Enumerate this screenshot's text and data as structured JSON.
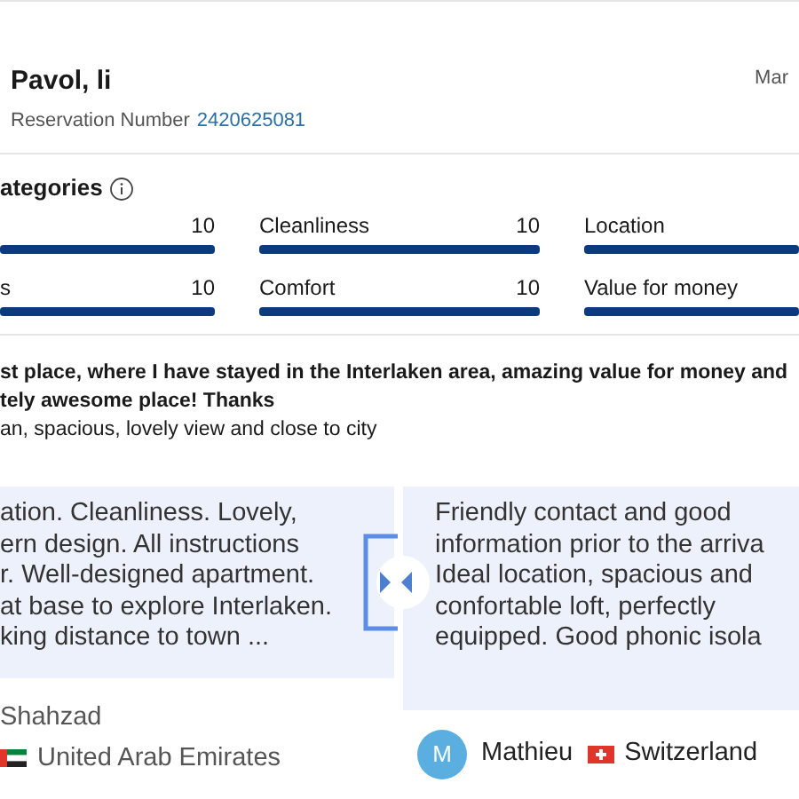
{
  "guest": {
    "name": "Pavol, li",
    "reservation_label": "Reservation Number",
    "reservation_number": "2420625081",
    "date": "Mar"
  },
  "categories": {
    "title": "ategories",
    "items": [
      {
        "score": "10",
        "level": 1
      },
      {
        "label": "Cleanliness",
        "score": "10",
        "level": 1
      },
      {
        "label": "Location",
        "level": 1
      },
      {
        "label": "s",
        "score": "10",
        "level": 1
      },
      {
        "label": "Comfort",
        "score": "10",
        "level": 1
      },
      {
        "label": "Value for money",
        "level": 1
      }
    ]
  },
  "review": {
    "title_lines": [
      "st place, where I have stayed in the Interlaken area, amazing value for money and",
      "tely awesome place! Thanks"
    ],
    "text": "an, spacious, lovely view and close to city"
  },
  "compare": [
    {
      "lines": [
        "ation. Cleanliness. Lovely,",
        "ern design. All instructions",
        "r. Well-designed apartment.",
        "at base to explore Interlaken.",
        "king distance to town ..."
      ],
      "name": "Shahzad",
      "country": "United Arab Emirates",
      "kind": "ae"
    },
    {
      "lines": [
        "Friendly contact and good",
        "information prior to the arriva",
        "Ideal location, spacious and",
        "confortable loft, perfectly",
        "equipped. Good phonic isola"
      ],
      "avatar": "M",
      "name": "Mathieu",
      "country": "Switzerland",
      "kind": "ch"
    }
  ]
}
